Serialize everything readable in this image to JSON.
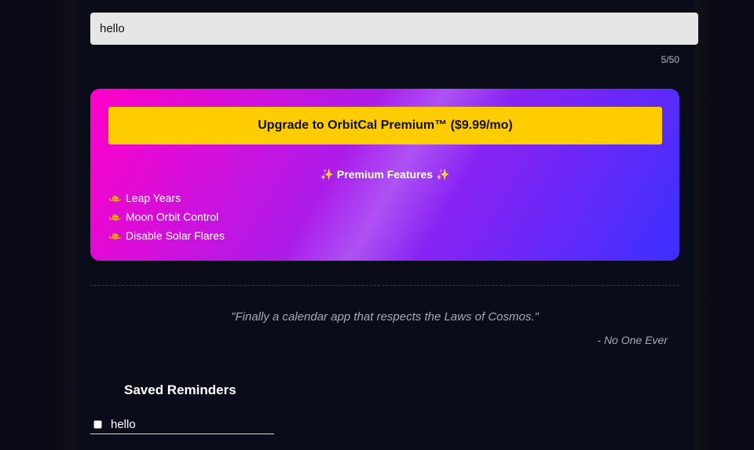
{
  "reminder_input": {
    "value": "hello",
    "char_count": "5/50"
  },
  "premium": {
    "upgrade_label": "Upgrade to OrbitCal Premium™ ($9.99/mo)",
    "features_title": "Premium Features",
    "features": [
      {
        "label": "Leap Years",
        "icon": "planet-icon"
      },
      {
        "label": "Moon Orbit Control",
        "icon": "planet-icon"
      },
      {
        "label": "Disable Solar Flares",
        "icon": "planet-icon"
      }
    ]
  },
  "testimonial": {
    "quote": "\"Finally a calendar app that respects the Laws of Cosmos.\"",
    "author": "- No One Ever"
  },
  "saved": {
    "title": "Saved Reminders",
    "items": [
      {
        "text": "hello",
        "checked": false
      }
    ]
  },
  "colors": {
    "accent_yellow": "#ffcc00",
    "card_pink": "#ff00c8",
    "card_blue": "#3a30ff"
  }
}
